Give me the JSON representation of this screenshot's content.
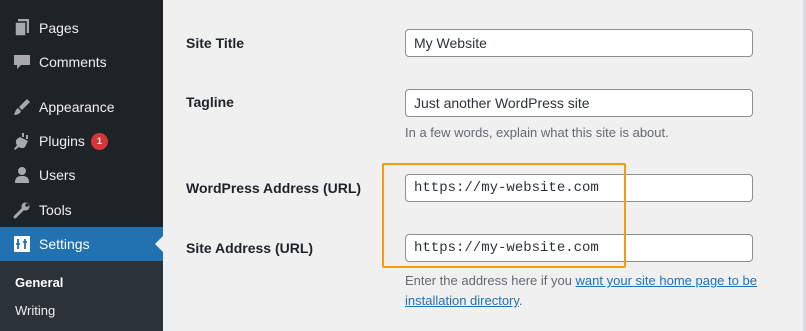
{
  "sidebar": {
    "items": [
      {
        "label": "Pages",
        "icon": "pages-icon"
      },
      {
        "label": "Comments",
        "icon": "comments-icon"
      },
      {
        "label": "Appearance",
        "icon": "appearance-icon"
      },
      {
        "label": "Plugins",
        "icon": "plugins-icon",
        "badge": "1"
      },
      {
        "label": "Users",
        "icon": "users-icon"
      },
      {
        "label": "Tools",
        "icon": "tools-icon"
      },
      {
        "label": "Settings",
        "icon": "settings-icon",
        "active": true
      }
    ],
    "submenu": [
      "General",
      "Writing"
    ]
  },
  "form": {
    "site_title_label": "Site Title",
    "site_title_value": "My Website",
    "tagline_label": "Tagline",
    "tagline_value": "Just another WordPress site",
    "tagline_desc": "In a few words, explain what this site is about.",
    "wp_address_label": "WordPress Address (URL)",
    "wp_address_value": "https://my-website.com",
    "site_address_label": "Site Address (URL)",
    "site_address_value": "https://my-website.com",
    "site_address_desc_prefix": "Enter the address here if you ",
    "site_address_desc_link": "want your site home page to be",
    "site_address_desc_link2": "installation directory",
    "site_address_desc_suffix": "."
  },
  "colors": {
    "sidebar_bg": "#1d2327",
    "active_bg": "#2271b1",
    "badge_bg": "#d63638",
    "highlight_border": "#f39c12"
  }
}
